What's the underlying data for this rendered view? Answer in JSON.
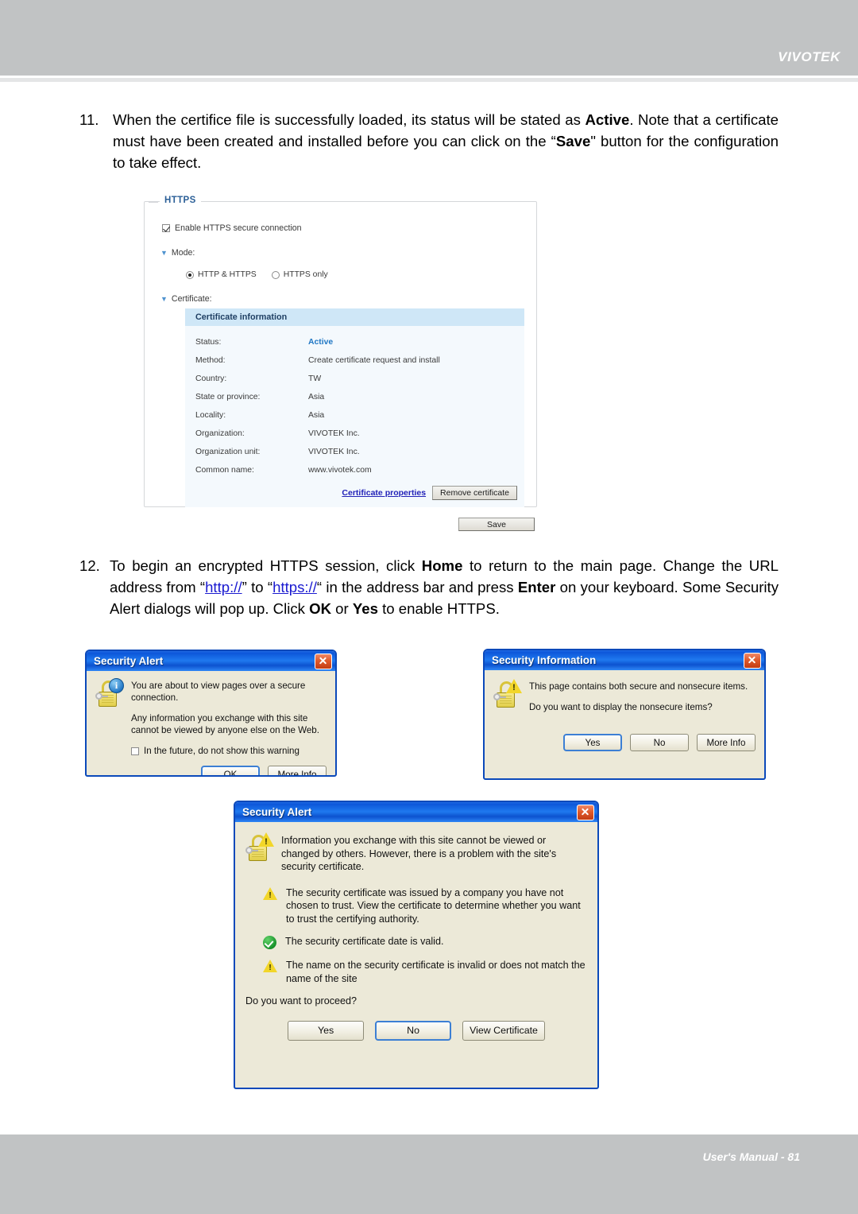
{
  "header": {
    "brand": "VIVOTEK"
  },
  "footer": {
    "folio": "User's Manual - 81"
  },
  "steps": {
    "step11": {
      "num": "11.",
      "part1": "When the certifice file is successfully loaded, its status will be stated as ",
      "bold1": "Active",
      "part2": ". Note that a certificate must have been created and installed before you can click on the “",
      "bold2": "Save",
      "part3": "\" button for the configuration to take effect."
    },
    "step12": {
      "num": "12.",
      "part1": "To begin an encrypted HTTPS session, click ",
      "bold1": "Home",
      "part2": " to return to the main page. Change the URL address from “",
      "link1": "http://",
      "part3": "” to “",
      "link2": "https://",
      "part4": "“ in the address bar and press ",
      "bold2": "Enter",
      "part5": " on your keyboard. Some Security Alert dialogs will pop up. Click ",
      "bold3": "OK",
      "part6": " or ",
      "bold4": "Yes",
      "part7": " to enable HTTPS."
    }
  },
  "https_panel": {
    "legend": "HTTPS",
    "enable_checkbox_label": "Enable HTTPS secure connection",
    "enable_checked": true,
    "mode_label": "Mode:",
    "mode_options": [
      {
        "label": "HTTP & HTTPS",
        "selected": true
      },
      {
        "label": "HTTPS only",
        "selected": false
      }
    ],
    "certificate_label": "Certificate:",
    "cert_table": {
      "title": "Certificate information",
      "rows": [
        {
          "key": "Status:",
          "value": "Active"
        },
        {
          "key": "Method:",
          "value": "Create certificate request and install"
        },
        {
          "key": "Country:",
          "value": "TW"
        },
        {
          "key": "State or province:",
          "value": "Asia"
        },
        {
          "key": "Locality:",
          "value": "Asia"
        },
        {
          "key": "Organization:",
          "value": "VIVOTEK Inc."
        },
        {
          "key": "Organization unit:",
          "value": "VIVOTEK Inc."
        },
        {
          "key": "Common name:",
          "value": "www.vivotek.com"
        }
      ],
      "properties_link": "Certificate properties",
      "remove_button": "Remove certificate"
    },
    "save_button": "Save",
    "colors": {
      "legend_blue": "#2b5f97",
      "table_header_bg": "#cfe7f7",
      "table_bg": "#f4f9fd",
      "status_active": "#2077c4",
      "link_blue": "#2222b8"
    }
  },
  "dialogs": {
    "security_alert_1": {
      "title": "Security Alert",
      "icon": "padlock-info-icon",
      "line1": "You are about to view pages over a secure connection.",
      "line2": "Any information you exchange with this site cannot be viewed by anyone else on the Web.",
      "checkbox_label": "In the future, do not show this warning",
      "checkbox_checked": false,
      "buttons": [
        {
          "label": "OK",
          "default": true
        },
        {
          "label": "More Info",
          "default": false
        }
      ]
    },
    "security_information": {
      "title": "Security Information",
      "icon": "padlock-warning-icon",
      "line1": "This page contains both secure and nonsecure items.",
      "line2": "Do you want to display the nonsecure items?",
      "buttons": [
        {
          "label": "Yes",
          "default": true
        },
        {
          "label": "No",
          "default": false
        },
        {
          "label": "More Info",
          "default": false
        }
      ]
    },
    "security_alert_2": {
      "title": "Security Alert",
      "icon": "padlock-warning-icon",
      "intro": "Information you exchange with this site cannot be viewed or changed by others. However, there is a problem with the site's security certificate.",
      "bullets": [
        {
          "icon": "warning-icon",
          "text": "The security certificate was issued by a company you have not chosen to trust. View the certificate to determine whether you want to trust the certifying authority."
        },
        {
          "icon": "check-ok-icon",
          "text": "The security certificate date is valid."
        },
        {
          "icon": "warning-icon",
          "text": "The name on the security certificate is invalid or does not match the name of the site"
        }
      ],
      "question": "Do you want to proceed?",
      "buttons": [
        {
          "label": "Yes",
          "default": false
        },
        {
          "label": "No",
          "default": true
        },
        {
          "label": "View Certificate",
          "default": false
        }
      ]
    }
  },
  "colors": {
    "header_gray": "#c1c3c4",
    "title_blue": "#0d57da",
    "dialog_face": "#ece9d8",
    "close_red": "#c33d14"
  }
}
